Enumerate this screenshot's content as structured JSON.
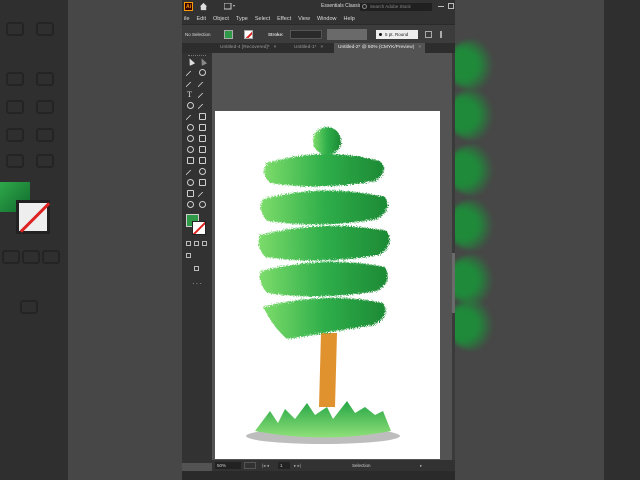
{
  "app": {
    "logo": "Ai",
    "workspace": "Essentials Classic",
    "search_placeholder": "Search Adobe Stock"
  },
  "menu": [
    "ile",
    "Edit",
    "Object",
    "Type",
    "Select",
    "Effect",
    "View",
    "Window",
    "Help"
  ],
  "control_bar": {
    "selection_state": "No Selection",
    "stroke_label": "Stroke:",
    "brush_label": "5 pt. Round",
    "fill_color": "#2e9a47"
  },
  "tabs": [
    {
      "label": "Untitled-4 [Recovered]*",
      "close": "×",
      "active": false
    },
    {
      "label": "Untitled-1*",
      "close": "×",
      "active": false
    },
    {
      "label": "Untitled-2* @ 50% (CMYK/Preview)",
      "close": "×",
      "active": true
    }
  ],
  "status": {
    "zoom": "50%",
    "page": "1",
    "prev": "|◂ ◂",
    "next": "▸ ▸|",
    "mode": "Selection",
    "arrow": "▸"
  },
  "artwork": {
    "foliage_dark": "#1d8a35",
    "foliage_mid": "#2fae4a",
    "foliage_light": "#7cdc6a",
    "trunk": "#e0922f",
    "grass_light": "#8fe079",
    "grass_dark": "#25a545",
    "shadow": "#bdbdbd"
  }
}
